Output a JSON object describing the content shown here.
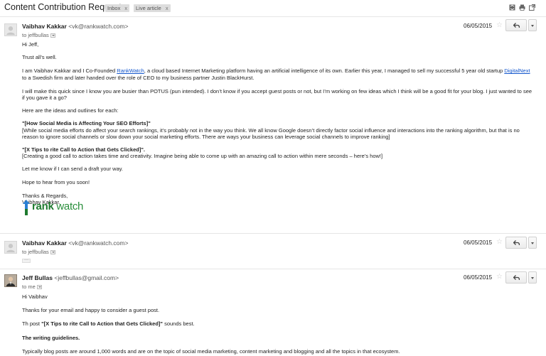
{
  "thread": {
    "subject": "Content Contribution Request",
    "labels": [
      "Inbox",
      "Live article"
    ],
    "label_close": "x",
    "icons": [
      "expand-all-icon",
      "print-icon",
      "new-window-icon"
    ]
  },
  "messages": [
    {
      "sender_name": "Vaibhav Kakkar",
      "sender_email": "<vk@rankwatch.com>",
      "to": "to jeffbullas",
      "date": "06/05/2015",
      "body": {
        "greeting": "Hi Jeff,",
        "p1": "Trust all’s well.",
        "p2a": "I am Vaibhav Kakkar and I Co-Founded ",
        "p2_link1": "RankWatch",
        "p2b": ", a cloud based Internet Marketing platform having an artificial intelligence of its own. Earlier this year, I managed to sell my successful 5 year old startup ",
        "p2_link2": "DigitalNext",
        "p2c": " to a Swedish firm and later handed over the role of CEO to my business partner Justin BlackHurst.",
        "p3": "I will make this quick since I know you are busier than POTUS (pun intended). I don’t know if you accept guest posts or not, but I’m working on few ideas which I think will be a good fit for your blog. I just wanted to see if you gave it a go?",
        "p4": "Here are the ideas and outlines for each:",
        "idea1_title": "\"[How Social Media is Affecting Your SEO Efforts]\"",
        "idea1_desc": "[While social media efforts do affect your search rankings, it’s probably not in the way you think. We all know Google doesn’t directly factor social influence and interactions into the ranking algorithm, but that is no reason to ignore social channels or slow down your social marketing efforts. There are ways your business can leverage social channels to improve ranking]",
        "idea2_title": "\"[X Tips to rite Call to Action that Gets Clicked]\".",
        "idea2_desc": "[Creating a good call to action takes time and creativity. Imagine being able to come up with an amazing call to action within mere seconds – here’s how!]",
        "p5": "Let me know if I can send a draft your way.",
        "p6": "Hope to hear from you soon!",
        "signoff1": "Thanks & Regards,",
        "signoff2": "Vaibhav Kakkar.",
        "logo_text_rank": "rank",
        "logo_text_watch": "watch"
      }
    },
    {
      "sender_name": "Vaibhav Kakkar",
      "sender_email": "<vk@rankwatch.com>",
      "to": "to jeffbullas",
      "date": "06/05/2015",
      "collapsed_marker": "···"
    },
    {
      "sender_name": "Jeff Bullas",
      "sender_email": "<jeffbullas@gmail.com>",
      "to": "to me",
      "date": "06/05/2015",
      "body": {
        "greeting": "Hi Vaibhav",
        "p1": "Thanks for your email and happy to consider a guest post.",
        "p2a": "Th post ",
        "p2_bold": "\"[X Tips to rite Call to Action that Gets Clicked]\"",
        "p2b": " sounds best.",
        "p3": "The writing guidelines.",
        "p4": "Typically blog posts are around 1,000 words and are on the topic of social media marketing, content marketing and blogging and all the topics in that ecosystem."
      }
    }
  ],
  "colors": {
    "link": "#1155cc",
    "logo_green": "#1e7a2f",
    "logo_blue": "#2a7fd4"
  }
}
